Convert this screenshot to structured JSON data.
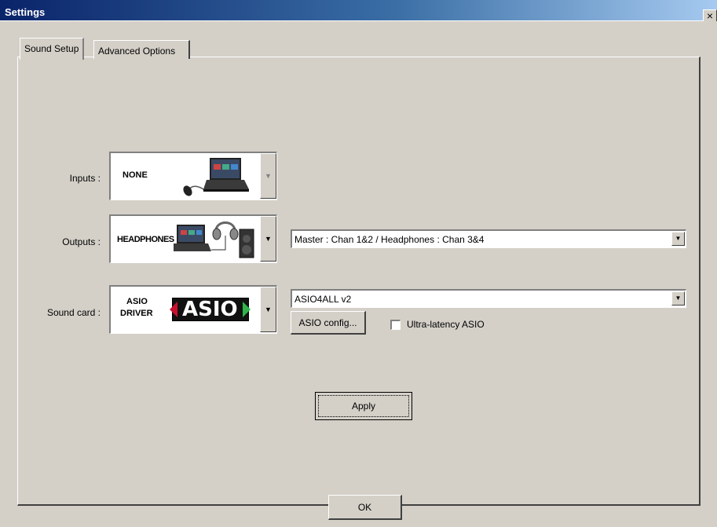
{
  "window": {
    "title": "Settings",
    "close_glyph": "×"
  },
  "tabs": [
    {
      "label": "Sound Setup",
      "active": true
    },
    {
      "label": "Advanced Options",
      "active": false
    }
  ],
  "inputs": {
    "label": "Inputs :",
    "selected": "NONE",
    "icon": "laptop-mouse-icon"
  },
  "outputs": {
    "label": "Outputs :",
    "selected": "HEADPHONES",
    "icon": "laptop-headphones-speaker-icon",
    "routing": "Master : Chan 1&2 / Headphones : Chan 3&4"
  },
  "sound_card": {
    "label": "Sound card :",
    "selected_line1": "ASIO",
    "selected_line2": "DRIVER",
    "logo_text": "ASIO",
    "driver": "ASIO4ALL v2",
    "config_button": "ASIO config...",
    "ultra_latency_label": "Ultra-latency ASIO",
    "ultra_latency_checked": false
  },
  "buttons": {
    "apply": "Apply",
    "ok": "OK"
  },
  "colors": {
    "title_start": "#0a246a",
    "title_end": "#a6caf0",
    "asio_red": "#c8102e",
    "asio_green": "#2fb34a"
  }
}
